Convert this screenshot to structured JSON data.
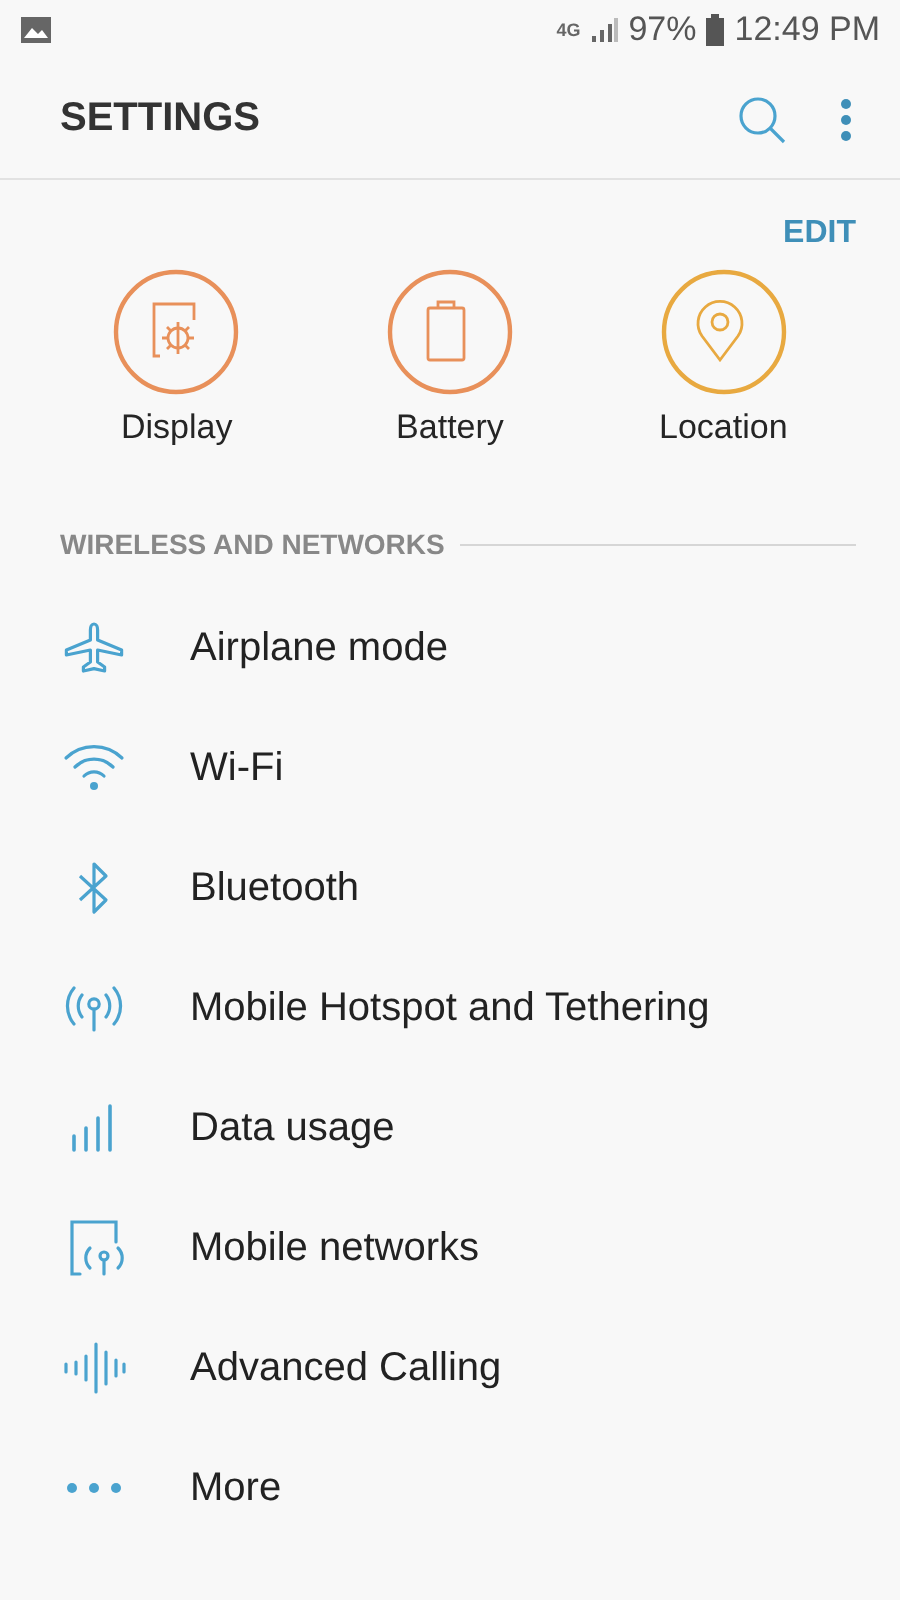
{
  "status_bar": {
    "network": "4G",
    "battery": "97%",
    "time": "12:49 PM"
  },
  "header": {
    "title": "SETTINGS"
  },
  "edit": "EDIT",
  "quick_settings": [
    {
      "kind": "display",
      "label": "Display",
      "color": "#e8905a"
    },
    {
      "kind": "battery",
      "label": "Battery",
      "color": "#e8905a"
    },
    {
      "kind": "location",
      "label": "Location",
      "color": "#e8a940"
    }
  ],
  "section": {
    "title": "WIRELESS AND NETWORKS"
  },
  "items": [
    {
      "kind": "airplane",
      "label": "Airplane mode"
    },
    {
      "kind": "wifi",
      "label": "Wi-Fi"
    },
    {
      "kind": "bluetooth",
      "label": "Bluetooth"
    },
    {
      "kind": "hotspot",
      "label": "Mobile Hotspot and Tethering"
    },
    {
      "kind": "data",
      "label": "Data usage"
    },
    {
      "kind": "networks",
      "label": "Mobile networks"
    },
    {
      "kind": "calling",
      "label": "Advanced Calling"
    },
    {
      "kind": "more",
      "label": "More"
    }
  ]
}
